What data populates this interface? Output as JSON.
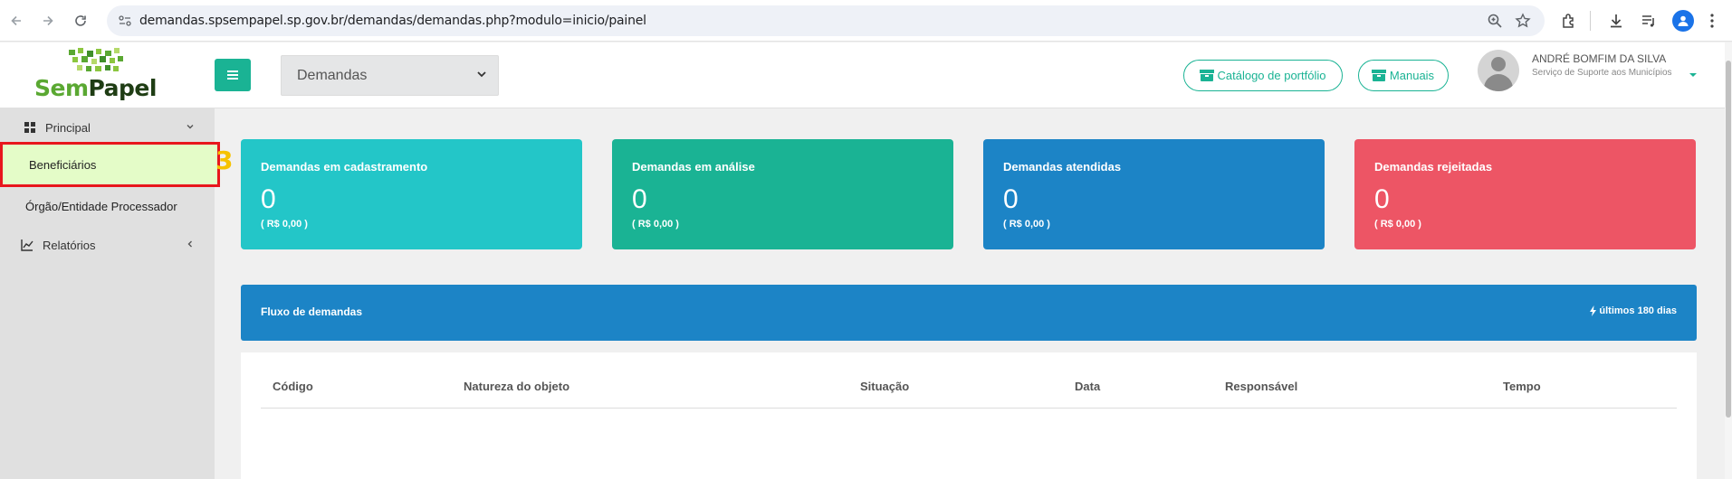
{
  "browser": {
    "url": "demandas.spsempapel.sp.gov.br/demandas/demandas.php?modulo=inicio/painel"
  },
  "header": {
    "logo_sem": "Sem",
    "logo_papel": "Papel",
    "module_select_value": "Demandas",
    "catalog_button": "Catálogo de portfólio",
    "manuals_button": "Manuais",
    "user_name": "ANDRÉ BOMFIM DA SILVA",
    "user_unit": "Serviço de Suporte aos Municípios"
  },
  "sidebar": {
    "principal": "Principal",
    "beneficiarios": "Beneficiários",
    "orgao": "Órgão/Entidade Processador",
    "relatorios": "Relatórios",
    "step_badge": "3"
  },
  "cards": [
    {
      "title": "Demandas em cadastramento",
      "value": "0",
      "sub": "( R$ 0,00 )",
      "color": "#23c6c8"
    },
    {
      "title": "Demandas em análise",
      "value": "0",
      "sub": "( R$ 0,00 )",
      "color": "#1ab394"
    },
    {
      "title": "Demandas atendidas",
      "value": "0",
      "sub": "( R$ 0,00 )",
      "color": "#1c84c6"
    },
    {
      "title": "Demandas rejeitadas",
      "value": "0",
      "sub": "( R$ 0,00 )",
      "color": "#ed5565"
    }
  ],
  "flow": {
    "title": "Fluxo de demandas",
    "period": "últimos 180 dias"
  },
  "table": {
    "columns": [
      "Código",
      "Natureza do objeto",
      "Situação",
      "Data",
      "Responsável",
      "Tempo"
    ]
  },
  "colors": {
    "accent": "#1ab394",
    "highlight_border": "#e8161d",
    "highlight_bg": "#e4fcc8"
  }
}
